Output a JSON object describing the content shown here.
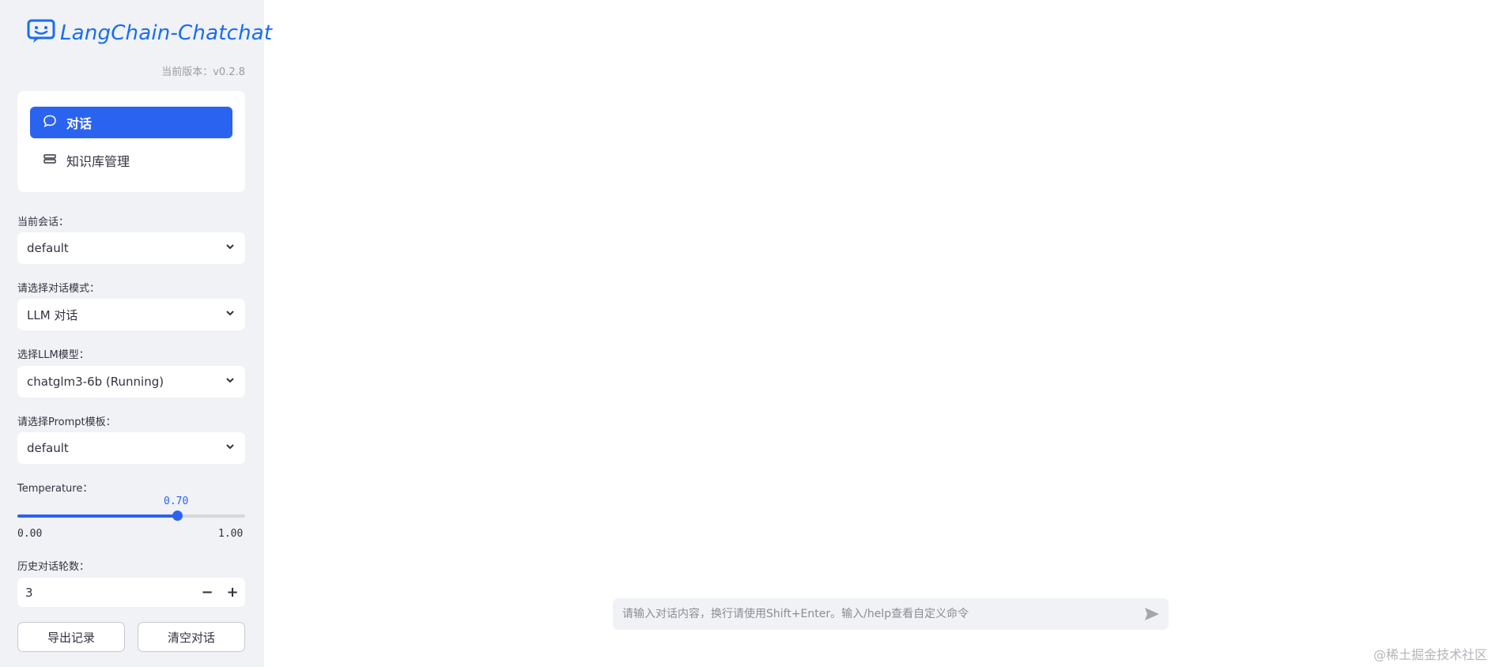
{
  "app": {
    "logo_text": "LangChain-Chatchat",
    "version": "当前版本：v0.2.8"
  },
  "nav": {
    "items": [
      {
        "label": "对话",
        "icon": "chat-bubble-icon",
        "active": true
      },
      {
        "label": "知识库管理",
        "icon": "database-icon",
        "active": false
      }
    ]
  },
  "fields": {
    "session_label": "当前会话：",
    "session_value": "default",
    "mode_label": "请选择对话模式：",
    "mode_value": "LLM 对话",
    "model_label": "选择LLM模型：",
    "model_value": "chatglm3-6b (Running)",
    "prompt_label": "请选择Prompt模板：",
    "prompt_value": "default"
  },
  "temperature": {
    "label": "Temperature：",
    "value": 0.7,
    "value_text": "0.70",
    "min_text": "0.00",
    "max_text": "1.00",
    "min": 0,
    "max": 1
  },
  "history": {
    "label": "历史对话轮数：",
    "value": "3",
    "minus": "−",
    "plus": "+"
  },
  "buttons": {
    "export": "导出记录",
    "clear": "清空对话"
  },
  "chat": {
    "placeholder": "请输入对话内容，换行请使用Shift+Enter。输入/help查看自定义命令"
  },
  "watermark": "@稀土掘金技术社区",
  "colors": {
    "accent": "#2b63f1",
    "sidebar_bg": "#f0f2f6",
    "logo": "#1a6cf0"
  }
}
